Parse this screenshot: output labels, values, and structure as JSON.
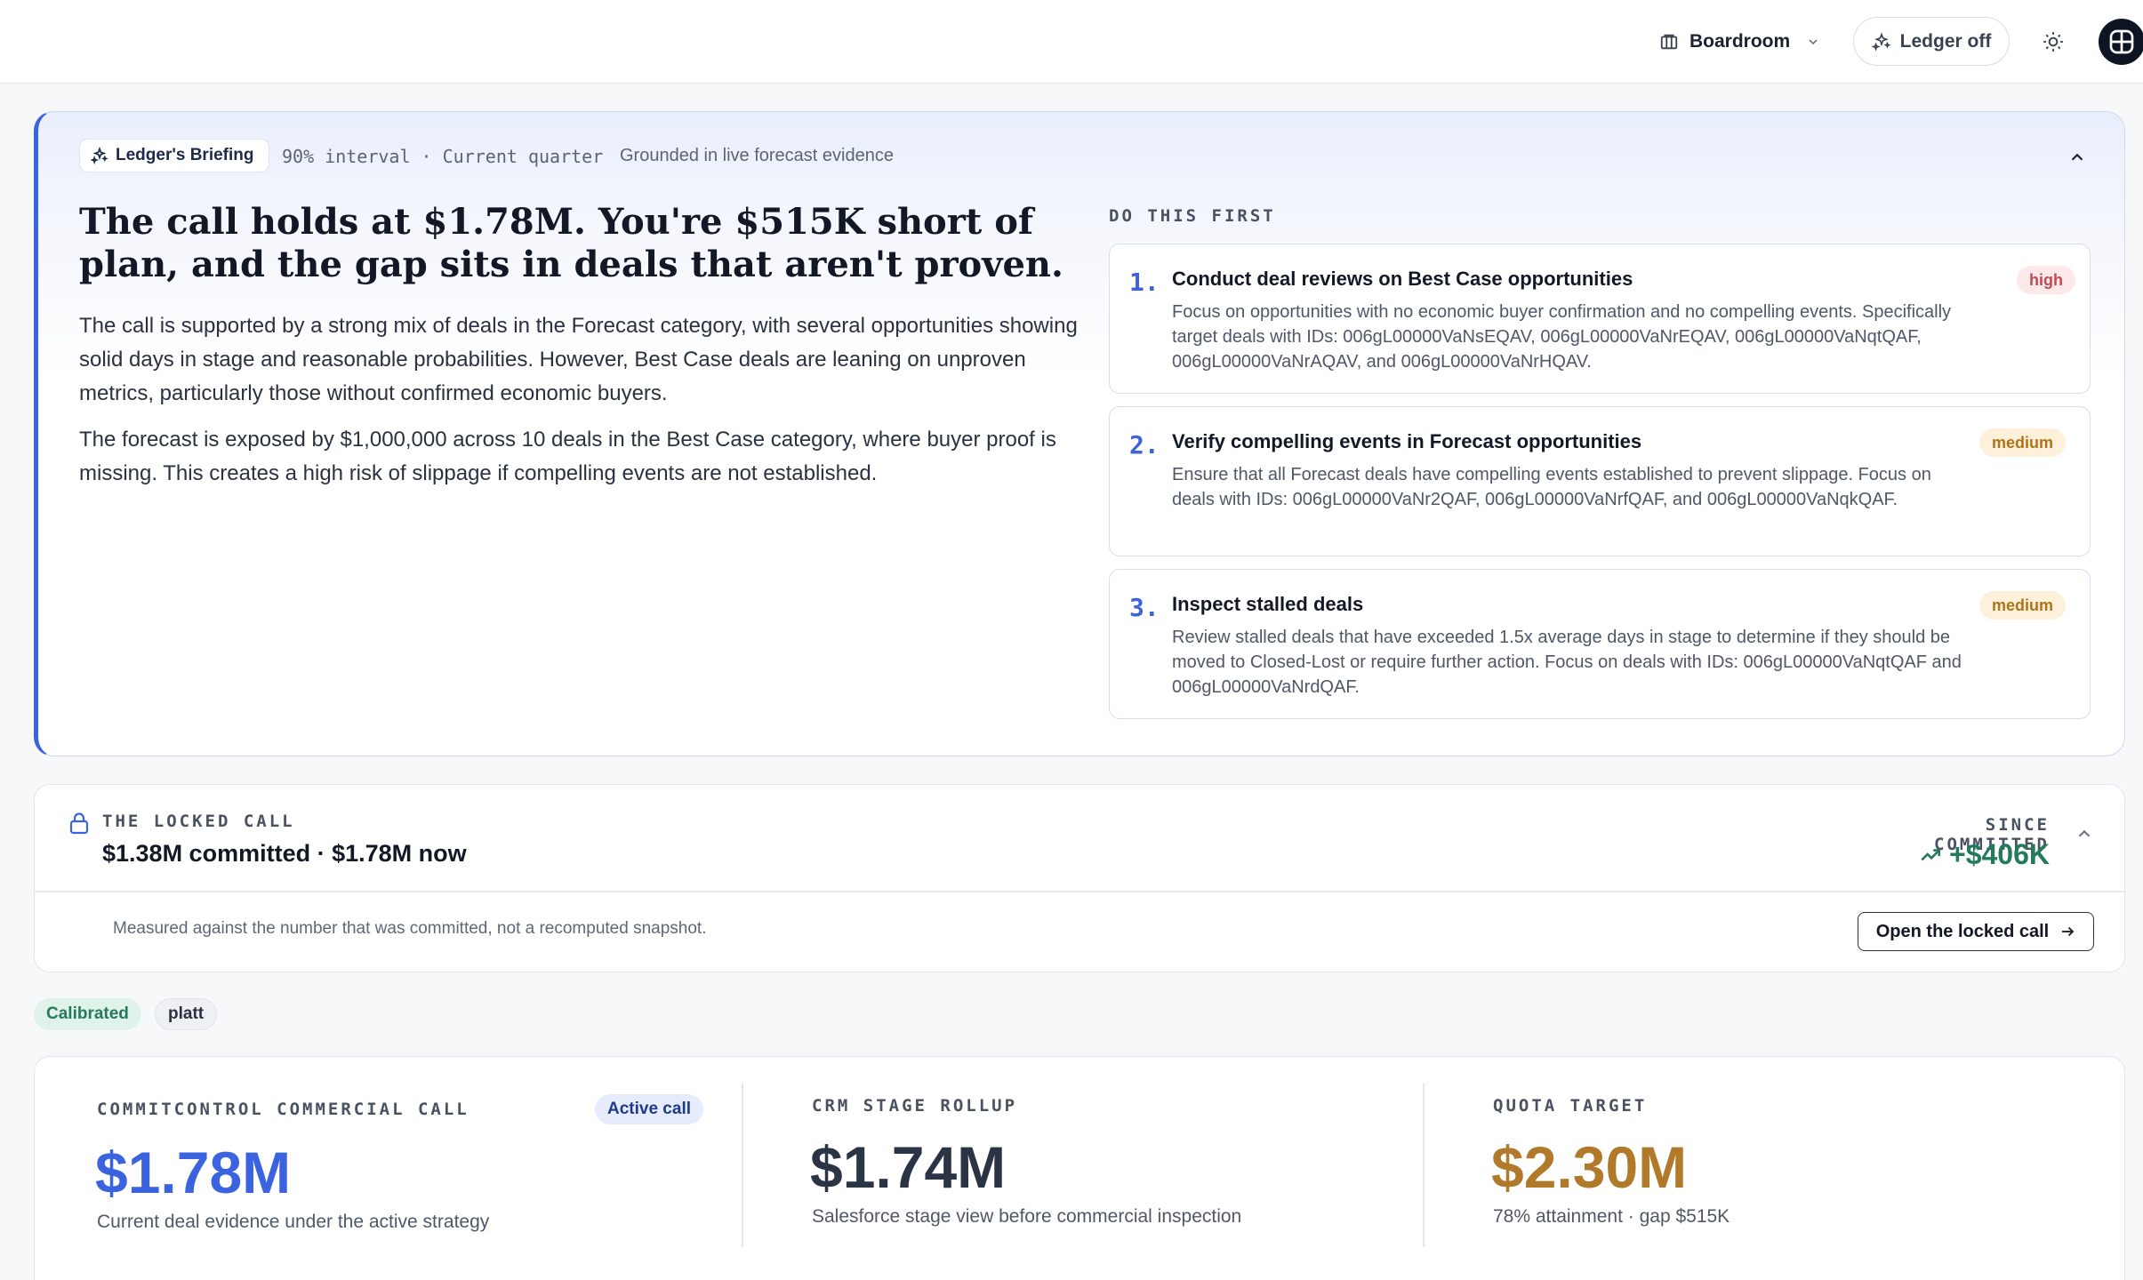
{
  "topbar": {
    "workspace": "Boardroom",
    "ledger_toggle": "Ledger off"
  },
  "briefing": {
    "pill": "Ledger's Briefing",
    "meta": "90% interval · Current quarter",
    "grounded": "Grounded in live forecast evidence",
    "headline": "The call holds at $1.78M. You're $515K short of plan, and the gap sits in deals that aren't proven.",
    "paragraphs": [
      "The call is supported by a strong mix of deals in the Forecast category, with several opportunities showing solid days in stage and reasonable probabilities. However, Best Case deals are leaning on unproven metrics, particularly those without confirmed economic buyers.",
      "The forecast is exposed by $1,000,000 across 10 deals in the Best Case category, where buyer proof is missing. This creates a high risk of slippage if compelling events are not established."
    ],
    "do_this_first_label": "DO THIS FIRST",
    "actions": [
      {
        "number": "1.",
        "title": "Conduct deal reviews on Best Case opportunities",
        "description": "Focus on opportunities with no economic buyer confirmation and no compelling events. Specifically target deals with IDs: 006gL00000VaNsEQAV, 006gL00000VaNrEQAV, 006gL00000VaNqtQAF, 006gL00000VaNrAQAV, and 006gL00000VaNrHQAV.",
        "priority": "high"
      },
      {
        "number": "2.",
        "title": "Verify compelling events in Forecast opportunities",
        "description": "Ensure that all Forecast deals have compelling events established to prevent slippage. Focus on deals with IDs: 006gL00000VaNr2QAF, 006gL00000VaNrfQAF, and 006gL00000VaNqkQAF.",
        "priority": "medium"
      },
      {
        "number": "3.",
        "title": "Inspect stalled deals",
        "description": "Review stalled deals that have exceeded 1.5x average days in stage to determine if they should be moved to Closed-Lost or require further action. Focus on deals with IDs: 006gL00000VaNqtQAF and 006gL00000VaNrdQAF.",
        "priority": "medium"
      }
    ]
  },
  "locked_call": {
    "label": "THE LOCKED CALL",
    "value": "$1.38M committed · $1.78M now",
    "since_label": "SINCE COMMITTED",
    "since_value": "+$406K",
    "note": "Measured against the number that was committed, not a recomputed snapshot.",
    "open_button": "Open the locked call"
  },
  "tags": [
    "Calibrated",
    "platt"
  ],
  "metrics": [
    {
      "label": "COMMITCONTROL COMMERCIAL CALL",
      "value": "$1.78M",
      "sub": "Current deal evidence under the active strategy",
      "badge": "Active call",
      "color": "#3b63e0"
    },
    {
      "label": "CRM STAGE ROLLUP",
      "value": "$1.74M",
      "sub": "Salesforce stage view before commercial inspection",
      "color": "#2a3445"
    },
    {
      "label": "QUOTA TARGET",
      "value": "$2.30M",
      "sub": "78% attainment · gap $515K",
      "color": "#b07a2a"
    }
  ],
  "colors": {
    "accent": "#3b63e0",
    "positive": "#267a5c",
    "high": "#c24a55",
    "medium": "#b07318"
  }
}
